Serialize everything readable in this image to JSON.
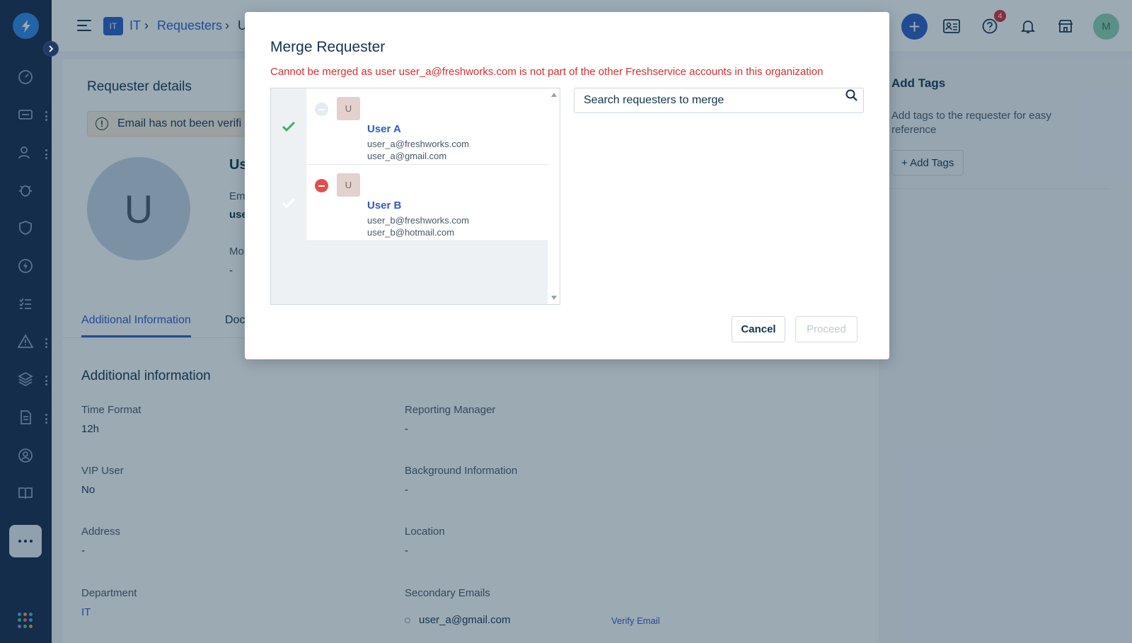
{
  "header": {
    "workspace_badge": "IT",
    "breadcrumb": [
      "IT",
      "Requesters",
      "U"
    ],
    "notification_count": "4",
    "avatar_initial": "M"
  },
  "page": {
    "details_title": "Requester details",
    "warning_text": "Email has not been verifi",
    "avatar_initial": "U",
    "name_partial": "Us",
    "email_label_partial": "Em",
    "email_value_partial": "use",
    "mobile_label_partial": "Mo",
    "mobile_value": "-",
    "tabs": [
      "Additional Information",
      "Doc"
    ],
    "section_title": "Additional information",
    "fields": [
      {
        "label": "Time Format",
        "value": "12h"
      },
      {
        "label": "Reporting Manager",
        "value": "-"
      },
      {
        "label": "VIP User",
        "value": "No"
      },
      {
        "label": "Background Information",
        "value": "-"
      },
      {
        "label": "Address",
        "value": "-"
      },
      {
        "label": "Location",
        "value": "-"
      },
      {
        "label": "Department",
        "value": "IT"
      },
      {
        "label": "Secondary Emails",
        "value": ""
      }
    ],
    "secondary_email": "user_a@gmail.com",
    "verify_email_link": "Verify Email"
  },
  "tags_panel": {
    "title": "Add Tags",
    "description": "Add tags to the requester for easy reference",
    "button": "+ Add Tags"
  },
  "modal": {
    "title": "Merge Requester",
    "error": "Cannot be merged as user user_a@freshworks.com is not part of the other Freshservice accounts in this organization",
    "users": [
      {
        "initial": "U",
        "name": "User A",
        "email1": "user_a@freshworks.com",
        "email2": "user_a@gmail.com",
        "primary": true
      },
      {
        "initial": "U",
        "name": "User B",
        "email1": "user_b@freshworks.com",
        "email2": "user_b@hotmail.com",
        "primary": false
      }
    ],
    "search_placeholder": "Search requesters to merge",
    "cancel_label": "Cancel",
    "proceed_label": "Proceed"
  },
  "colors": {
    "sidebar": "#13294b",
    "primary": "#2c5cc5",
    "error": "#d72d30",
    "success": "#3fae6a"
  }
}
